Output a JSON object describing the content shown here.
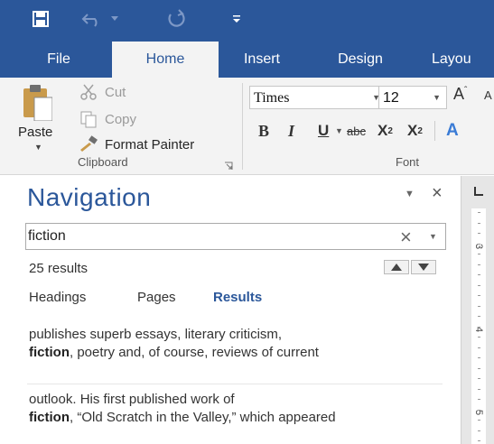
{
  "quick_access": {
    "save_icon": "save-icon",
    "undo_icon": "undo-icon",
    "redo_icon": "redo-icon",
    "customize_icon": "customize-qat-icon"
  },
  "tabs": [
    {
      "label": "File",
      "active": false
    },
    {
      "label": "Home",
      "active": true
    },
    {
      "label": "Insert",
      "active": false
    },
    {
      "label": "Design",
      "active": false
    },
    {
      "label": "Layou",
      "active": false
    }
  ],
  "clipboard": {
    "paste_label": "Paste",
    "cut_label": "Cut",
    "copy_label": "Copy",
    "format_painter_label": "Format Painter",
    "group_label": "Clipboard"
  },
  "font": {
    "name": "Times",
    "size": "12",
    "group_label": "Font",
    "grow_label": "A",
    "shrink_label": "A",
    "bold_label": "B",
    "italic_label": "I",
    "underline_label": "U",
    "strike_label": "abc",
    "subscript_label": "X",
    "superscript_label": "X",
    "effects_label": "A"
  },
  "navigation": {
    "title": "Navigation",
    "search_value": "fiction",
    "results_count": "25 results",
    "view_tabs": [
      "Headings",
      "Pages",
      "Results"
    ],
    "results": [
      {
        "before": "publishes superb essays, literary criticism,",
        "match": "fiction",
        "after": ", poetry and, of course, reviews of current"
      },
      {
        "before": "outlook.  His first published work of",
        "match": "fiction",
        "after": ", “Old Scratch in the Valley,” which appeared"
      }
    ]
  },
  "ruler": {
    "labels": [
      "3",
      "4",
      "5"
    ]
  },
  "colors": {
    "accent": "#2b579a",
    "ribbon_bg": "#f3f3f3"
  }
}
